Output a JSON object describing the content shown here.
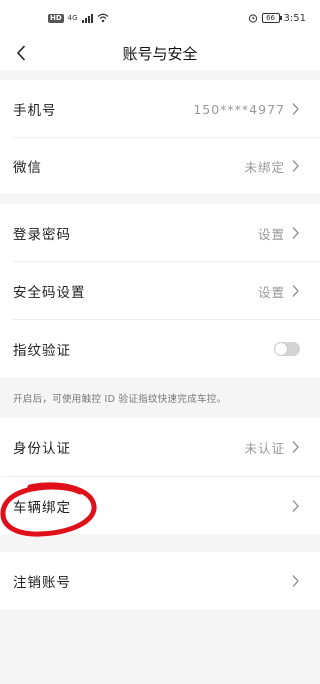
{
  "status_bar": {
    "network_badge": "HD",
    "network_type": "4G",
    "battery_level": "66",
    "time": "3:51"
  },
  "nav": {
    "title": "账号与安全"
  },
  "rows": {
    "phone": {
      "label": "手机号",
      "value": "150****4977"
    },
    "wechat": {
      "label": "微信",
      "value": "未绑定"
    },
    "login_password": {
      "label": "登录密码",
      "value": "设置"
    },
    "security_code": {
      "label": "安全码设置",
      "value": "设置"
    },
    "fingerprint": {
      "label": "指纹验证",
      "enabled": false
    },
    "identity": {
      "label": "身份认证",
      "value": "未认证"
    },
    "vehicle_binding": {
      "label": "车辆绑定"
    },
    "cancel_account": {
      "label": "注销账号"
    }
  },
  "fingerprint_hint": "开启后，可使用触控 ID 验证指纹快速完成车控。",
  "colors": {
    "annotation": "#e0101a",
    "toggle_off": "#d4d4d4",
    "secondary_text": "#999999"
  }
}
